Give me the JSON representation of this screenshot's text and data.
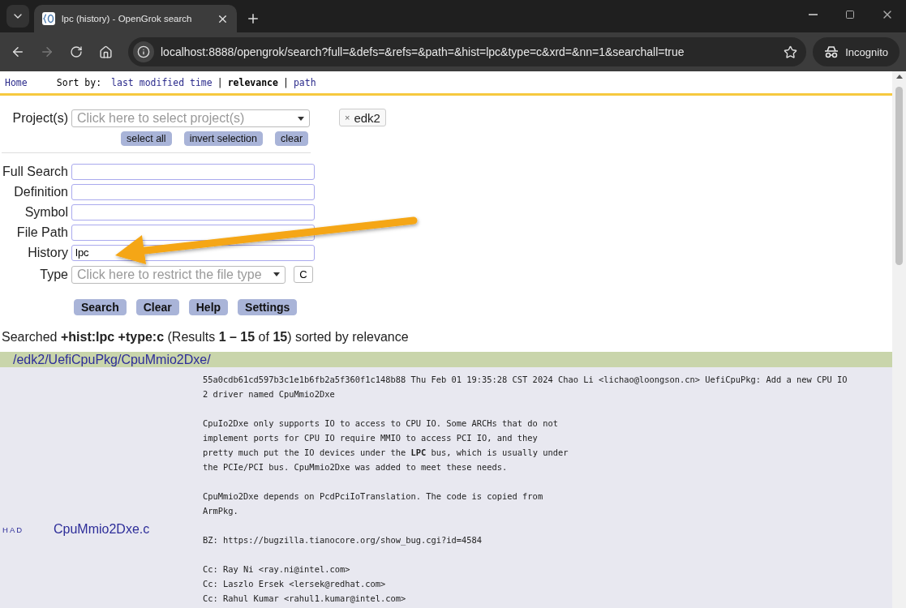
{
  "browser": {
    "tab": {
      "title": "lpc (history) - OpenGrok search",
      "selected": true
    },
    "url": "localhost:8888/opengrok/search?full=&defs=&refs=&path=&hist=lpc&type=c&xrd=&nn=1&searchall=true",
    "profile": "Incognito"
  },
  "nav": {
    "home": "Home",
    "sort_label": "Sort by:",
    "sort_options": [
      {
        "label": "last modified time",
        "selected": false
      },
      {
        "label": "relevance",
        "selected": true
      },
      {
        "label": "path",
        "selected": false
      }
    ],
    "separators": [
      "|",
      "|"
    ]
  },
  "form": {
    "projects": {
      "label": "Project(s)",
      "placeholder": "Click here to select project(s)",
      "buttons": [
        "select all",
        "invert selection",
        "clear"
      ],
      "chips": [
        {
          "remove": "×",
          "label": "edk2"
        }
      ]
    },
    "fields": [
      {
        "label": "Full Search"
      },
      {
        "label": "Definition"
      },
      {
        "label": "Symbol"
      },
      {
        "label": "File Path"
      },
      {
        "label": "History",
        "value": "lpc"
      }
    ],
    "type": {
      "label": "Type",
      "placeholder": "Click here to restrict the file type",
      "clear": "C"
    },
    "buttons": [
      "Search",
      "Clear",
      "Help",
      "Settings"
    ]
  },
  "summary": "Searched **+hist:lpc +type:c** (Results **1 – 15** of **15**) sorted by relevance",
  "results": [
    {
      "directory": "/edk2/UefiCpuPkg/CpuMmio2Dxe/",
      "files": [
        {
          "tags": [
            "H",
            "A",
            "D"
          ],
          "name": "CpuMmio2Dxe.c",
          "message": [
            [
              "55a0cdb61cd597b3c1e1b6fb2a5f360f1c148b88 Thu Feb 01 19:35:28 CST 2024 Chao Li <lichao@loongson.cn> UefiCpuPkg: Add a new CPU IO",
              "2 driver named CpuMmio2Dxe"
            ],
            [
              "CpuIo2Dxe only supports IO to access to CPU IO. Some ARCHs that do not",
              "implement ports for CPU IO require MMIO to access PCI IO, and they",
              "pretty much put the IO devices under the **LPC** bus, which is usually under",
              "the PCIe/PCI bus. CpuMmio2Dxe was added to meet these needs."
            ],
            [
              "CpuMmio2Dxe depends on PcdPciIoTranslation. The code is copied from",
              "ArmPkg."
            ],
            [
              "BZ: https://bugzilla.tianocore.org/show_bug.cgi?id=4584"
            ],
            [
              "Cc: Ray Ni <ray.ni@intel.com>",
              "Cc: Laszlo Ersek <lersek@redhat.com>",
              "Cc: Rahul Kumar <rahul1.kumar@intel.com>"
            ]
          ]
        }
      ]
    }
  ]
}
